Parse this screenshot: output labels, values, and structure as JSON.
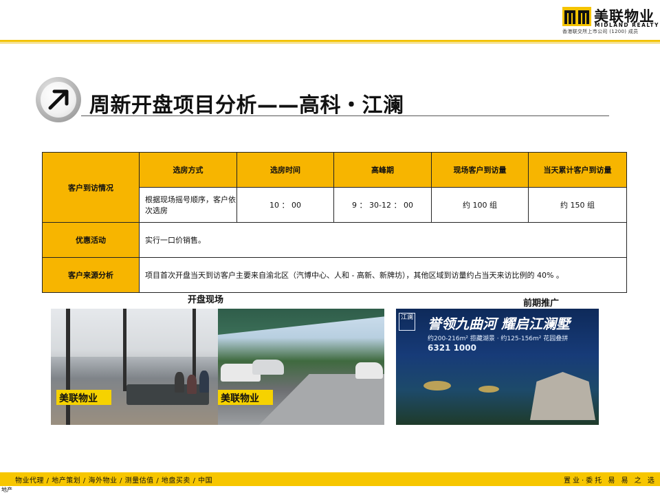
{
  "brand": {
    "name_cn": "美联物业",
    "name_en": "MIDLAND REALTY",
    "sub": "香港联交所上市公司 (1200) 成员"
  },
  "title": "周新开盘项目分析——高科・江澜",
  "table": {
    "row1_header": "客户到访情况",
    "columns": [
      "选房方式",
      "选房时间",
      "高峰期",
      "现场客户到访量",
      "当天累计客户到访量"
    ],
    "values": [
      "根据现场摇号顺序，客户依次选房",
      "10 ： 00",
      "9 ： 30-12 ： 00",
      "约 100 组",
      "约 150 组"
    ],
    "promo_label": "优惠活动",
    "promo_value": "实行一口价销售。",
    "source_label": "客户来源分析",
    "source_value": "项目首次开盘当天到访客户主要来自渝北区（汽博中心、人和 - 高新、新牌坊），其他区域到访量约占当天来访比例的 40% 。"
  },
  "sections": {
    "opening_site": "开盘现场",
    "pre_promo": "前期推广"
  },
  "photos": {
    "watermark": "美联物业",
    "ad_headline": "誉领九曲河  耀启江澜墅",
    "ad_sub": "约200-216m² 揽藏湖景  ·  约125-156m² 花园叠拼",
    "ad_phone": "6321 1000",
    "ad_tag": "江澜"
  },
  "footer": {
    "left": "物业代理 /  地产策划 /  海外物业 /  测量估值 /  地盘买卖 /  中国",
    "right": "置业·委托 易 易 之 选",
    "corner": "地产"
  },
  "colors": {
    "accent": "#f7b500",
    "bar": "#f7c600"
  }
}
